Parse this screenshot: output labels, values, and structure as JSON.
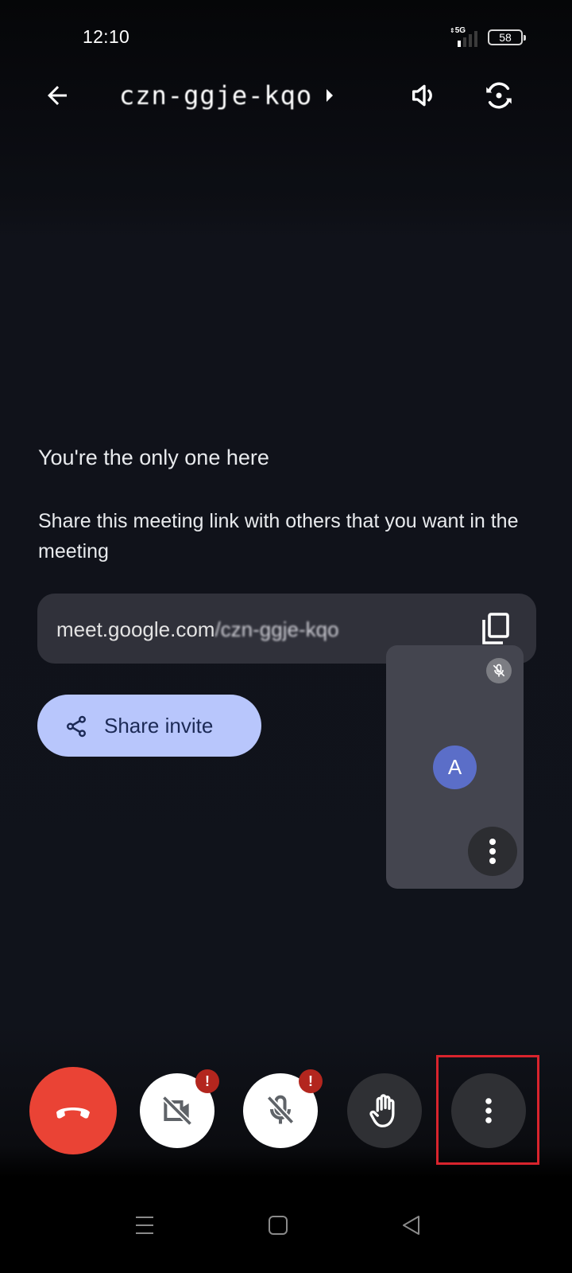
{
  "status_bar": {
    "time": "12:10",
    "network_label": "5G",
    "signal_icon": "signal-bars-icon",
    "battery_percent": "58"
  },
  "appbar": {
    "back_icon": "arrow-back-icon",
    "meeting_code": "czn-ggje-kqo",
    "expand_icon": "caret-right-icon",
    "speaker_icon": "volume-icon",
    "flip_camera_icon": "flip-camera-icon"
  },
  "main": {
    "heading": "You're the only one here",
    "description": "Share this meeting link with others that you want in the meeting",
    "link_prefix": "meet.google.com",
    "link_suffix": "/czn-ggje-kqo",
    "copy_icon": "copy-icon",
    "share_button_label": "Share invite",
    "share_icon": "share-icon"
  },
  "self_tile": {
    "avatar_initial": "A",
    "avatar_color": "#5b6ec8",
    "mic_icon": "mic-off-icon",
    "more_icon": "more-vertical-icon"
  },
  "controls": [
    {
      "name": "end-call",
      "icon": "call-end-icon",
      "color": "#ea4335"
    },
    {
      "name": "camera",
      "icon": "videocam-off-icon",
      "warning": "!"
    },
    {
      "name": "microphone",
      "icon": "mic-off-icon",
      "warning": "!"
    },
    {
      "name": "raise-hand",
      "icon": "hand-icon"
    },
    {
      "name": "more-options",
      "icon": "more-vertical-icon",
      "highlighted": true
    }
  ],
  "colors": {
    "accent_button": "#b8c6fc",
    "end_call": "#ea4335",
    "warning_badge": "#b3261e",
    "highlight_box": "#d9242d"
  },
  "navbar": {
    "recents_icon": "menu-lines-icon",
    "home_icon": "home-square-icon",
    "back_icon": "back-triangle-icon"
  }
}
